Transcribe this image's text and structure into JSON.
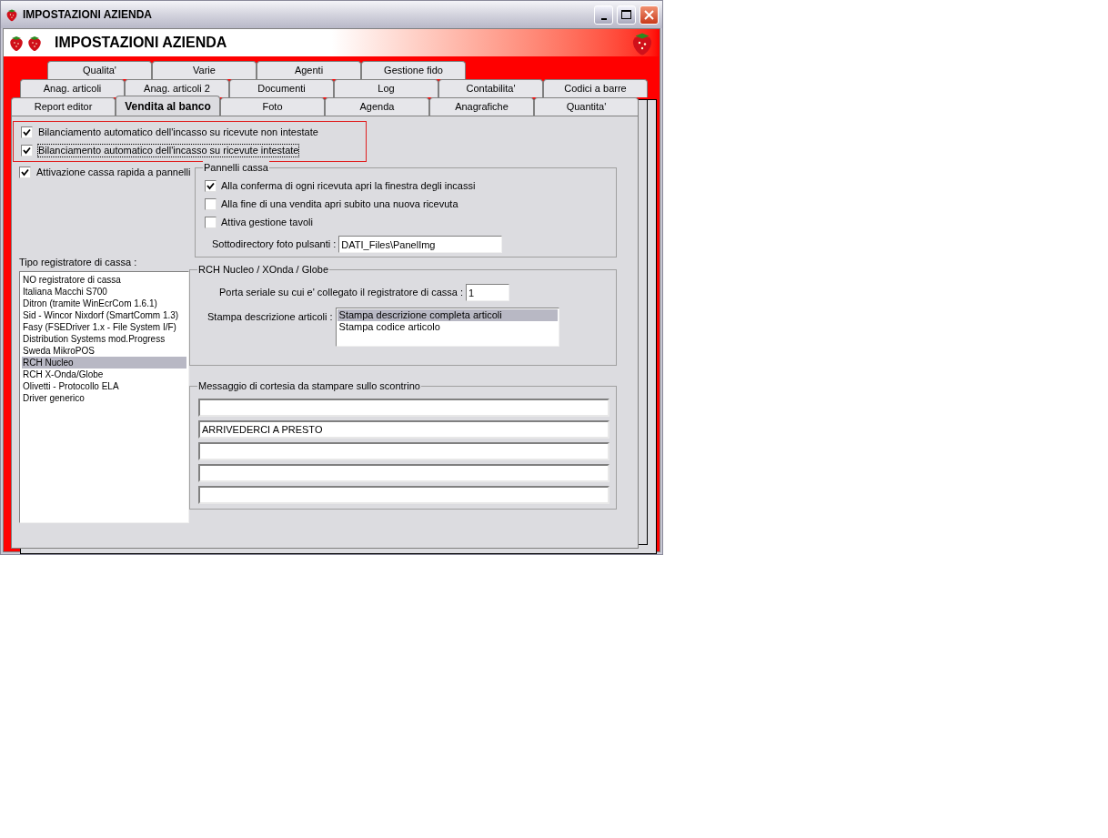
{
  "window": {
    "title": "IMPOSTAZIONI AZIENDA"
  },
  "header": {
    "title": "IMPOSTAZIONI AZIENDA"
  },
  "tab_rows": [
    [
      {
        "label": "Qualita'",
        "selected": false
      },
      {
        "label": "Varie",
        "selected": false
      },
      {
        "label": "Agenti",
        "selected": false
      },
      {
        "label": "Gestione fido",
        "selected": false
      }
    ],
    [
      {
        "label": "Anag. articoli",
        "selected": false
      },
      {
        "label": "Anag. articoli 2",
        "selected": false
      },
      {
        "label": "Documenti",
        "selected": false
      },
      {
        "label": "Log",
        "selected": false
      },
      {
        "label": "Contabilita'",
        "selected": false
      },
      {
        "label": "Codici a barre",
        "selected": false
      }
    ],
    [
      {
        "label": "Report editor",
        "selected": false
      },
      {
        "label": "Vendita al banco",
        "selected": true
      },
      {
        "label": "Foto",
        "selected": false
      },
      {
        "label": "Agenda",
        "selected": false
      },
      {
        "label": "Anagrafiche",
        "selected": false
      },
      {
        "label": "Quantita'",
        "selected": false
      }
    ]
  ],
  "balance_checks": [
    {
      "label": "Bilanciamento automatico dell'incasso su ricevute non intestate",
      "checked": true,
      "focused": false
    },
    {
      "label": "Bilanciamento automatico dell'incasso su ricevute intestate",
      "checked": true,
      "focused": true
    }
  ],
  "quick_checkbox": {
    "label": "Attivazione cassa rapida a pannelli",
    "checked": true
  },
  "register": {
    "label": "Tipo registratore di cassa :",
    "items": [
      {
        "label": "NO registratore di cassa",
        "selected": false
      },
      {
        "label": "Italiana Macchi S700",
        "selected": false
      },
      {
        "label": "Ditron (tramite WinEcrCom 1.6.1)",
        "selected": false
      },
      {
        "label": "Sid - Wincor Nixdorf (SmartComm 1.3)",
        "selected": false
      },
      {
        "label": "Fasy (FSEDriver 1.x - File System I/F)",
        "selected": false
      },
      {
        "label": "Distribution Systems mod.Progress",
        "selected": false
      },
      {
        "label": "Sweda MikroPOS",
        "selected": false
      },
      {
        "label": "RCH Nucleo",
        "selected": true
      },
      {
        "label": "RCH X-Onda/Globe",
        "selected": false
      },
      {
        "label": "Olivetti - Protocollo ELA",
        "selected": false
      },
      {
        "label": "Driver generico",
        "selected": false
      }
    ]
  },
  "panels_group": {
    "title": "Pannelli cassa",
    "checks": [
      {
        "label": "Alla conferma di ogni ricevuta apri la finestra degli incassi",
        "checked": true
      },
      {
        "label": "Alla fine di una vendita apri subito una nuova ricevuta",
        "checked": false
      },
      {
        "label": "Attiva gestione tavoli",
        "checked": false
      }
    ],
    "photo_label": "Sottodirectory foto pulsanti :",
    "photo_value": "DATI_Files\\PanelImg"
  },
  "rch_group": {
    "title": "RCH Nucleo / XOnda / Globe",
    "port_label": "Porta seriale su cui e' collegato il registratore di cassa :",
    "port_value": "1",
    "print_label": "Stampa descrizione articoli :",
    "print_options": [
      {
        "label": "Stampa descrizione completa articoli",
        "selected": true
      },
      {
        "label": "Stampa codice articolo",
        "selected": false
      }
    ]
  },
  "message_group": {
    "title": "Messaggio di cortesia da stampare sullo scontrino",
    "lines": [
      {
        "kind": "blank"
      },
      {
        "kind": "filled",
        "value": "ARRIVEDERCI A PRESTO"
      },
      {
        "kind": "blank"
      },
      {
        "kind": "blank"
      },
      {
        "kind": "blank"
      }
    ]
  }
}
